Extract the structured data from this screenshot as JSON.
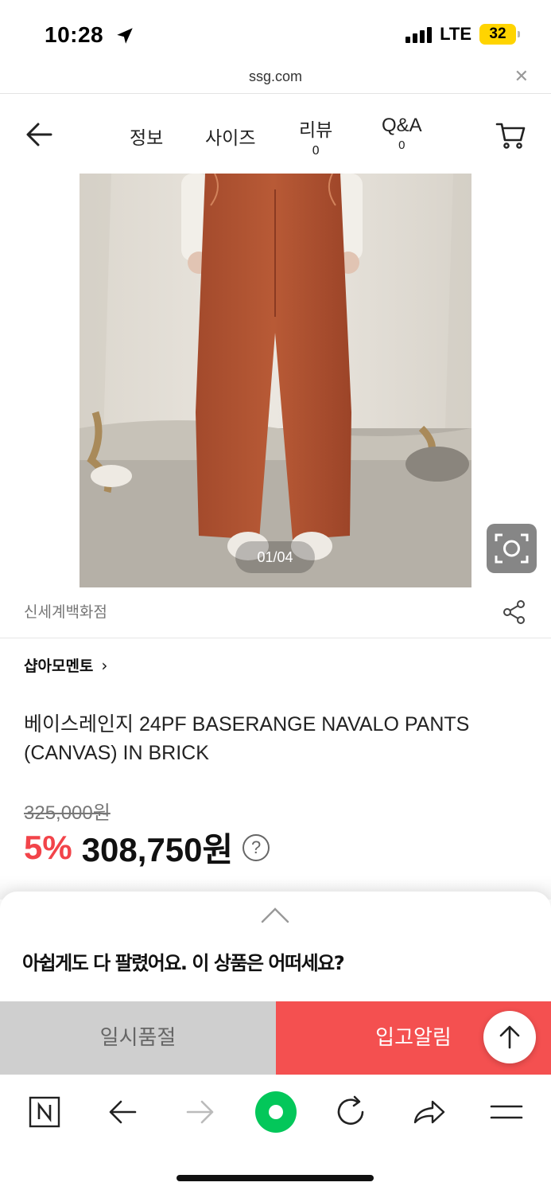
{
  "status_bar": {
    "time": "10:28",
    "network": "LTE",
    "battery": "32"
  },
  "url_bar": {
    "url": "ssg.com",
    "close_symbol": "✕"
  },
  "header": {
    "tabs": [
      {
        "label": "정보"
      },
      {
        "label": "사이즈"
      },
      {
        "label": "리뷰",
        "count": "0"
      },
      {
        "label": "Q&A",
        "count": "0"
      }
    ]
  },
  "gallery": {
    "counter": "01/04"
  },
  "brand": {
    "name": "신세계백화점"
  },
  "shop": {
    "name": "샵아모멘토",
    "chevron": "›"
  },
  "product": {
    "title": "베이스레인지 24PF BASERANGE NAVALO PANTS (CANVAS) IN BRICK",
    "original_price": "325,000원",
    "discount": "5%",
    "sale_price": "308,750원",
    "help_symbol": "?"
  },
  "sheet": {
    "message": "아쉽게도 다 팔렸어요. 이 상품은 어떠세요?"
  },
  "actions": {
    "soldout_label": "일시품절",
    "notify_label": "입고알림"
  },
  "toolbar": {
    "items": [
      "naver-icon",
      "back-arrow-icon",
      "forward-arrow-icon",
      "green-dot-icon",
      "refresh-icon",
      "share-icon",
      "menu-icon"
    ]
  },
  "colors": {
    "accent_red": "#f45050",
    "discount_red": "#f2444a",
    "soldout_gray": "#cfcfcf",
    "naver_green": "#03c75a",
    "battery_yellow": "#ffd400"
  }
}
